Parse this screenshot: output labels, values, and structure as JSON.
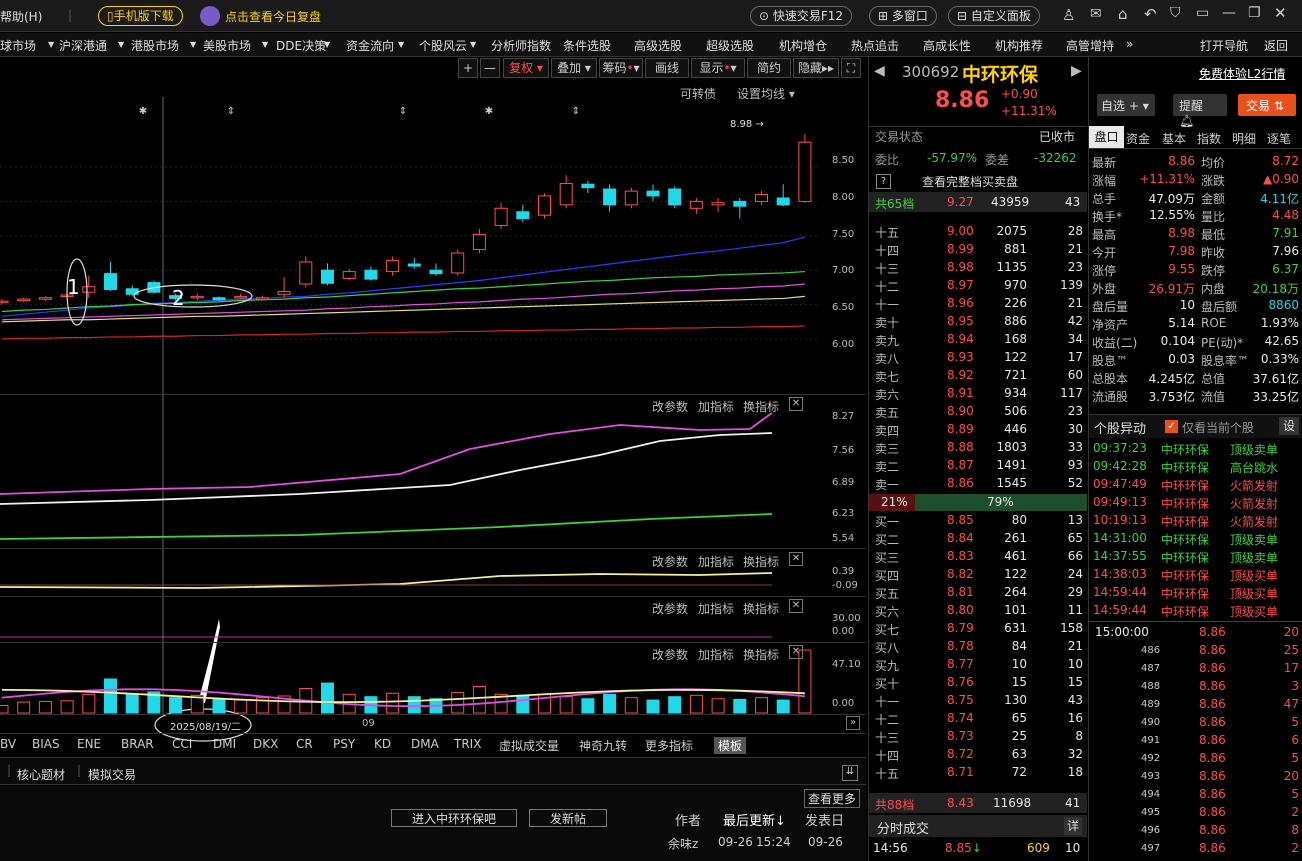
{
  "topbar": {
    "help": "帮助(H)",
    "mobile": "手机版下载",
    "review": "点击查看今日复盘",
    "trade": "快速交易F12",
    "multi": "多窗口",
    "custom": "自定义面板"
  },
  "menu": [
    "球市场",
    "沪深港通",
    "港股市场",
    "美股市场",
    "DDE决策",
    "资金流向",
    "个股风云",
    "分析师指数",
    "条件选股",
    "高级选股",
    "超级选股",
    "机构增仓",
    "热点追击",
    "高成长性",
    "机构推荐",
    "高管增持"
  ],
  "menu_right": {
    "nav": "打开导航",
    "back": "返回"
  },
  "chart_tools": {
    "plus": "+",
    "minus": "—",
    "fuquan": "复权",
    "diejia": "叠加",
    "chouma": "筹码",
    "huaxian": "画线",
    "xianshi": "显示",
    "jianyue": "简约",
    "yincang": "隐藏",
    "kzz": "可转债",
    "setma": "设置均线"
  },
  "chart_data": {
    "type": "candlestick",
    "yticks_main": [
      "8.50",
      "8.00",
      "7.50",
      "7.00",
      "6.50",
      "6.00"
    ],
    "last_high": "8.98",
    "candles": [
      [
        6.53,
        6.55,
        6.5,
        6.58
      ],
      [
        6.56,
        6.58,
        6.54,
        6.6
      ],
      [
        6.58,
        6.6,
        6.55,
        6.62
      ],
      [
        6.62,
        6.64,
        6.58,
        6.7
      ],
      [
        6.68,
        6.76,
        6.6,
        6.92
      ],
      [
        6.95,
        6.72,
        6.7,
        7.12
      ],
      [
        6.73,
        6.65,
        6.62,
        6.78
      ],
      [
        6.82,
        6.68,
        6.66,
        6.85
      ],
      [
        6.63,
        6.59,
        6.56,
        6.66
      ],
      [
        6.6,
        6.62,
        6.57,
        6.66
      ],
      [
        6.6,
        6.57,
        6.55,
        6.62
      ],
      [
        6.6,
        6.62,
        6.58,
        6.66
      ],
      [
        6.58,
        6.6,
        6.56,
        6.63
      ],
      [
        6.65,
        6.69,
        6.6,
        6.9
      ],
      [
        6.8,
        7.12,
        6.75,
        7.2
      ],
      [
        7.0,
        6.81,
        6.78,
        7.1
      ],
      [
        6.88,
        6.98,
        6.85,
        7.02
      ],
      [
        7.0,
        6.87,
        6.85,
        7.05
      ],
      [
        6.98,
        7.14,
        6.92,
        7.2
      ],
      [
        7.09,
        7.06,
        7.02,
        7.18
      ],
      [
        7.0,
        6.95,
        6.92,
        7.1
      ],
      [
        6.96,
        7.25,
        6.92,
        7.3
      ],
      [
        7.3,
        7.52,
        7.25,
        7.6
      ],
      [
        7.65,
        7.9,
        7.6,
        7.98
      ],
      [
        7.85,
        7.75,
        7.7,
        7.95
      ],
      [
        7.8,
        8.08,
        7.75,
        8.12
      ],
      [
        7.95,
        8.26,
        7.9,
        8.38
      ],
      [
        8.25,
        8.2,
        8.12,
        8.3
      ],
      [
        8.18,
        7.95,
        7.85,
        8.25
      ],
      [
        7.95,
        8.15,
        7.9,
        8.2
      ],
      [
        8.15,
        8.08,
        8.0,
        8.25
      ],
      [
        8.18,
        7.95,
        7.9,
        8.22
      ],
      [
        7.9,
        8.0,
        7.82,
        8.05
      ],
      [
        7.95,
        7.98,
        7.85,
        8.05
      ],
      [
        8.0,
        7.93,
        7.75,
        8.05
      ],
      [
        8.0,
        8.1,
        7.95,
        8.15
      ],
      [
        8.05,
        7.95,
        7.93,
        8.25
      ],
      [
        8.0,
        8.86,
        7.98,
        8.98
      ]
    ],
    "ma": {
      "blue": [
        6.33,
        6.36,
        6.39,
        6.42,
        6.45,
        6.47,
        6.49,
        6.52,
        6.53,
        6.55,
        6.56,
        6.58,
        6.59,
        6.61,
        6.62,
        6.65,
        6.67,
        6.7,
        6.73,
        6.76,
        6.79,
        6.82,
        6.85,
        6.89,
        6.93,
        6.97,
        7.01,
        7.05,
        7.09,
        7.13,
        7.17,
        7.21,
        7.25,
        7.28,
        7.32,
        7.36,
        7.4,
        7.48
      ],
      "green": [
        6.4,
        6.42,
        6.43,
        6.45,
        6.47,
        6.48,
        6.5,
        6.51,
        6.52,
        6.53,
        6.54,
        6.56,
        6.57,
        6.58,
        6.6,
        6.61,
        6.63,
        6.65,
        6.67,
        6.69,
        6.71,
        6.73,
        6.74,
        6.76,
        6.78,
        6.8,
        6.82,
        6.84,
        6.85,
        6.87,
        6.89,
        6.9,
        6.91,
        6.93,
        6.94,
        6.95,
        6.96,
        6.98
      ],
      "magenta": [
        6.28,
        6.29,
        6.3,
        6.31,
        6.32,
        6.33,
        6.34,
        6.35,
        6.36,
        6.37,
        6.38,
        6.39,
        6.4,
        6.41,
        6.42,
        6.44,
        6.45,
        6.47,
        6.48,
        6.5,
        6.51,
        6.53,
        6.54,
        6.56,
        6.58,
        6.59,
        6.61,
        6.63,
        6.65,
        6.66,
        6.68,
        6.7,
        6.71,
        6.73,
        6.74,
        6.76,
        6.77,
        6.8
      ],
      "yellow": [
        6.25,
        6.26,
        6.27,
        6.28,
        6.28,
        6.29,
        6.3,
        6.31,
        6.32,
        6.33,
        6.33,
        6.34,
        6.35,
        6.36,
        6.37,
        6.38,
        6.39,
        6.4,
        6.41,
        6.42,
        6.43,
        6.44,
        6.45,
        6.46,
        6.47,
        6.48,
        6.49,
        6.5,
        6.51,
        6.52,
        6.53,
        6.54,
        6.55,
        6.56,
        6.57,
        6.58,
        6.59,
        6.62
      ],
      "red": [
        6.0,
        6.01,
        6.01,
        6.02,
        6.02,
        6.03,
        6.03,
        6.04,
        6.04,
        6.05,
        6.05,
        6.06,
        6.06,
        6.07,
        6.07,
        6.08,
        6.08,
        6.09,
        6.09,
        6.1,
        6.1,
        6.11,
        6.11,
        6.12,
        6.12,
        6.13,
        6.13,
        6.14,
        6.14,
        6.15,
        6.15,
        6.16,
        6.16,
        6.17,
        6.17,
        6.18,
        6.18,
        6.19
      ]
    },
    "vol": [
      0.22,
      0.32,
      0.34,
      0.36,
      0.55,
      1.0,
      0.55,
      0.62,
      0.45,
      0.52,
      0.42,
      0.38,
      0.45,
      0.5,
      0.72,
      0.88,
      0.55,
      0.48,
      0.58,
      0.48,
      0.42,
      0.6,
      0.78,
      0.55,
      0.52,
      0.55,
      0.48,
      0.42,
      0.55,
      0.45,
      0.38,
      0.48,
      0.52,
      0.42,
      0.4,
      0.45,
      0.38,
      1.85
    ]
  },
  "panels": {
    "p1": [
      "8.27",
      "7.56",
      "6.89",
      "6.23",
      "5.54"
    ],
    "p2": [
      "0.39",
      "-0.09"
    ],
    "p3": [
      "30.00",
      "0.00"
    ],
    "p4": [
      "47.10",
      "0.00"
    ],
    "gai": "改参数",
    "jia": "加指标",
    "huan": "换指标"
  },
  "annot": {
    "one": "1",
    "two": "2",
    "date": "2025/08/19/二",
    "month": "09"
  },
  "ind_tabs": [
    "BV",
    "BIAS",
    "ENE",
    "BRAR",
    "CCI",
    "DMI",
    "DKX",
    "CR",
    "PSY",
    "KD",
    "DMA",
    "TRIX",
    "虚拟成交量",
    "神奇九转",
    "更多指标",
    "模板"
  ],
  "bottom": {
    "tab1": "核心题材",
    "tab2": "模拟交易",
    "more": "查看更多",
    "enter": "进入中环环保吧",
    "post": "发新帖",
    "author": "作者",
    "last": "最后更新",
    "pub": "发表日",
    "u1": "余味z",
    "t1a": "09-26",
    "t1b": "15:24",
    "t1c": "09-26"
  },
  "stock": {
    "code": "300692",
    "name": "中环环保",
    "price": "8.86",
    "chg": "+0.90",
    "pct": "+11.31%",
    "l2": "免费体验L2行情",
    "zixuan": "自选",
    "tixing": "提醒",
    "jiaoyi": "交易"
  },
  "status": {
    "label": "交易状态",
    "value": "已收市",
    "weibi": "委比",
    "weibi_v": "-57.97%",
    "weicha": "委差",
    "weicha_v": "-32262",
    "full": "查看完整档买卖盘",
    "gong65": "共65档",
    "g65p": "9.27",
    "g65v": "43959",
    "g65n": "43"
  },
  "asks": [
    [
      "十五",
      "9.00",
      "2075",
      "28"
    ],
    [
      "十四",
      "8.99",
      "881",
      "21"
    ],
    [
      "十三",
      "8.98",
      "1135",
      "23"
    ],
    [
      "十二",
      "8.97",
      "970",
      "139"
    ],
    [
      "十一",
      "8.96",
      "226",
      "21"
    ],
    [
      "卖十",
      "8.95",
      "886",
      "42"
    ],
    [
      "卖九",
      "8.94",
      "168",
      "34"
    ],
    [
      "卖八",
      "8.93",
      "122",
      "17"
    ],
    [
      "卖七",
      "8.92",
      "721",
      "60"
    ],
    [
      "卖六",
      "8.91",
      "934",
      "117"
    ],
    [
      "卖五",
      "8.90",
      "506",
      "23"
    ],
    [
      "卖四",
      "8.89",
      "446",
      "30"
    ],
    [
      "卖三",
      "8.88",
      "1803",
      "33"
    ],
    [
      "卖二",
      "8.87",
      "1491",
      "93"
    ],
    [
      "卖一",
      "8.86",
      "1545",
      "52"
    ]
  ],
  "ratio": {
    "left": "21%",
    "right": "79%"
  },
  "bids": [
    [
      "买一",
      "8.85",
      "80",
      "13"
    ],
    [
      "买二",
      "8.84",
      "261",
      "65"
    ],
    [
      "买三",
      "8.83",
      "461",
      "66"
    ],
    [
      "买四",
      "8.82",
      "122",
      "24"
    ],
    [
      "买五",
      "8.81",
      "264",
      "29"
    ],
    [
      "买六",
      "8.80",
      "101",
      "11"
    ],
    [
      "买七",
      "8.79",
      "631",
      "158"
    ],
    [
      "买八",
      "8.78",
      "84",
      "21"
    ],
    [
      "买九",
      "8.77",
      "10",
      "10"
    ],
    [
      "买十",
      "8.76",
      "15",
      "15"
    ],
    [
      "十一",
      "8.75",
      "130",
      "43"
    ],
    [
      "十二",
      "8.74",
      "65",
      "16"
    ],
    [
      "十三",
      "8.73",
      "25",
      "8"
    ],
    [
      "十四",
      "8.72",
      "63",
      "32"
    ],
    [
      "十五",
      "8.71",
      "72",
      "18"
    ]
  ],
  "gong88": {
    "label": "共88档",
    "p": "8.43",
    "v": "11698",
    "n": "41"
  },
  "fenshi": {
    "label": "分时成交",
    "btn": "详",
    "time": "14:56",
    "p": "8.85",
    "v": "609",
    "n": "10"
  },
  "dtabs": [
    "盘口",
    "资金",
    "基本",
    "指数",
    "明细",
    "逐笔"
  ],
  "dstats": [
    [
      "最新",
      "8.86",
      "均价",
      "8.72"
    ],
    [
      "涨幅",
      "+11.31%",
      "涨跌",
      "▲0.90"
    ],
    [
      "总手",
      "47.09万",
      "金额",
      "4.11亿"
    ],
    [
      "换手*",
      "12.55%",
      "量比",
      "4.48"
    ],
    [
      "最高",
      "8.98",
      "最低",
      "7.91"
    ],
    [
      "今开",
      "7.98",
      "昨收",
      "7.96"
    ],
    [
      "涨停",
      "9.55",
      "跌停",
      "6.37"
    ],
    [
      "外盘",
      "26.91万",
      "内盘",
      "20.18万"
    ],
    [
      "盘后量",
      "10",
      "盘后额",
      "8860"
    ],
    [
      "净资产",
      "5.14",
      "ROE",
      "1.93%"
    ],
    [
      "收益(二)",
      "0.104",
      "PE(动)*",
      "42.65"
    ],
    [
      "股息™",
      "0.03",
      "股息率™",
      "0.33%"
    ],
    [
      "总股本",
      "4.245亿",
      "总值",
      "37.61亿"
    ],
    [
      "流通股",
      "3.753亿",
      "流值",
      "33.25亿"
    ]
  ],
  "yidong": {
    "label": "个股异动",
    "chk": "仅看当前个股",
    "set": "设"
  },
  "events": [
    [
      "09:37:23",
      "中环环保",
      "顶级卖单",
      "g"
    ],
    [
      "09:42:28",
      "中环环保",
      "高台跳水",
      "g"
    ],
    [
      "09:47:49",
      "中环环保",
      "火箭发射",
      "r"
    ],
    [
      "09:49:13",
      "中环环保",
      "火箭发射",
      "r"
    ],
    [
      "10:19:13",
      "中环环保",
      "火箭发射",
      "r"
    ],
    [
      "14:31:00",
      "中环环保",
      "顶级卖单",
      "g"
    ],
    [
      "14:37:55",
      "中环环保",
      "顶级卖单",
      "g"
    ],
    [
      "14:38:03",
      "中环环保",
      "顶级买单",
      "r"
    ],
    [
      "14:59:44",
      "中环环保",
      "顶级买单",
      "r"
    ],
    [
      "14:59:44",
      "中环环保",
      "顶级买单",
      "r"
    ]
  ],
  "ticks": [
    [
      "15:00:00",
      "8.86",
      "20"
    ],
    [
      "486",
      "8.86",
      "25"
    ],
    [
      "487",
      "8.86",
      "17"
    ],
    [
      "488",
      "8.86",
      "3"
    ],
    [
      "489",
      "8.86",
      "47"
    ],
    [
      "490",
      "8.86",
      "5"
    ],
    [
      "491",
      "8.86",
      "6"
    ],
    [
      "492",
      "8.86",
      "5"
    ],
    [
      "493",
      "8.86",
      "20"
    ],
    [
      "494",
      "8.86",
      "5"
    ],
    [
      "495",
      "8.86",
      "2"
    ],
    [
      "496",
      "8.86",
      "8"
    ],
    [
      "497",
      "8.86",
      "2"
    ]
  ]
}
